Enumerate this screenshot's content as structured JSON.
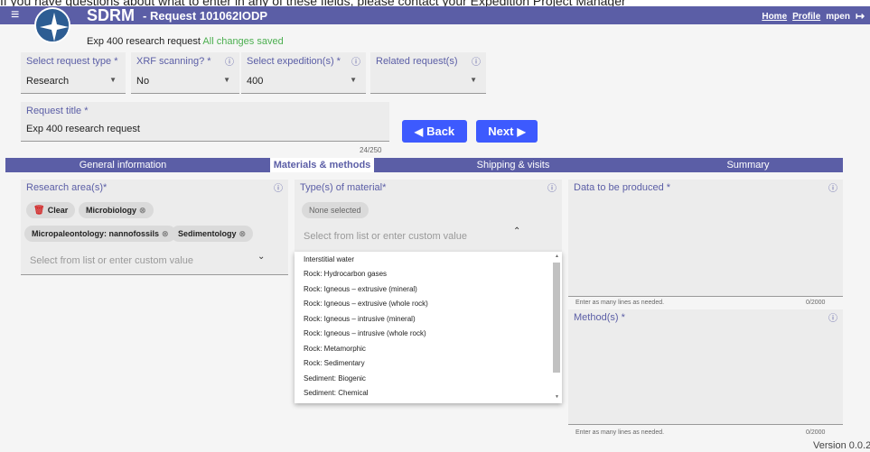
{
  "banner": "If you have questions about what to enter in any of these fields, please contact your Expedition Project Manager",
  "header": {
    "app_title": "SDRM",
    "request_id": "- Request 101062IODP",
    "nav": {
      "home": "Home",
      "profile": "Profile",
      "user": "mpen",
      "logout_icon": "logout-icon"
    }
  },
  "subtitle": {
    "text": "Exp 400 research request",
    "status": "All changes saved"
  },
  "fields": {
    "request_type": {
      "label": "Select request type *",
      "value": "Research"
    },
    "xrf": {
      "label": "XRF scanning? *",
      "value": "No"
    },
    "expedition": {
      "label": "Select expedition(s) *",
      "value": "400"
    },
    "related": {
      "label": "Related request(s)",
      "value": ""
    },
    "title": {
      "label": "Request title *",
      "value": "Exp 400 research request",
      "counter": "24/250"
    }
  },
  "buttons": {
    "back": "Back",
    "next": "Next"
  },
  "tabs": [
    "General information",
    "Materials & methods",
    "Shipping & visits",
    "Summary"
  ],
  "active_tab": 1,
  "research_area": {
    "label": "Research area(s)*",
    "clear": "Clear",
    "chips": [
      "Microbiology",
      "Micropaleontology: nannofossils",
      "Sedimentology"
    ],
    "placeholder": "Select from list or enter custom value"
  },
  "material": {
    "label": "Type(s) of material*",
    "none": "None selected",
    "placeholder": "Select from list or enter custom value",
    "options": [
      "Interstitial water",
      "Rock: Hydrocarbon gases",
      "Rock: Igneous – extrusive (mineral)",
      "Rock: Igneous – extrusive (whole rock)",
      "Rock: Igneous – intrusive (mineral)",
      "Rock: Igneous – intrusive (whole rock)",
      "Rock: Metamorphic",
      "Rock: Sedimentary",
      "Sediment: Biogenic",
      "Sediment: Chemical"
    ]
  },
  "data_produced": {
    "label": "Data to be produced *",
    "hint": "Enter as many lines as needed.",
    "counter": "0/2000"
  },
  "methods": {
    "label": "Method(s) *",
    "hint": "Enter as many lines as needed.",
    "counter": "0/2000"
  },
  "version": "Version  0.0.2",
  "colors": {
    "primary": "#5b5ea6",
    "button": "#3d5afe",
    "saved": "#4caf50"
  }
}
